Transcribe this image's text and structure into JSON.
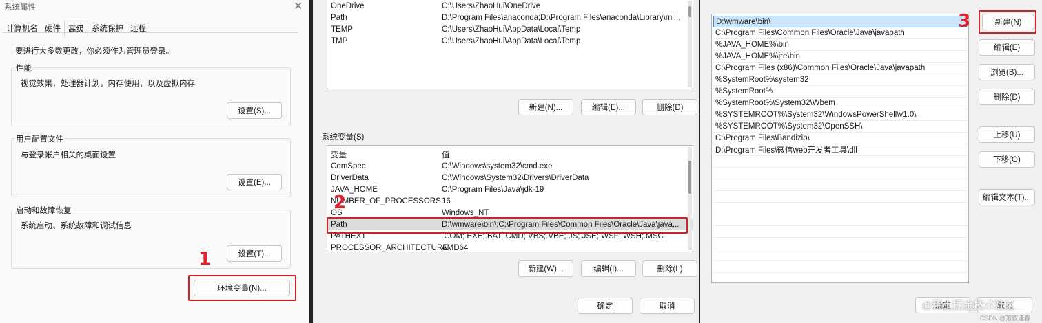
{
  "p1": {
    "title": "系统属性",
    "tabs": [
      "计算机名",
      "硬件",
      "高级",
      "系统保护",
      "远程"
    ],
    "admin_note": "要进行大多数更改，你必须作为管理员登录。",
    "perf": {
      "label": "性能",
      "desc": "视觉效果，处理器计划，内存使用，以及虚拟内存",
      "button": "设置(S)..."
    },
    "profile": {
      "label": "用户配置文件",
      "desc": "与登录帐户相关的桌面设置",
      "button": "设置(E)..."
    },
    "startup": {
      "label": "启动和故障恢复",
      "desc": "系统启动、系统故障和调试信息",
      "button": "设置(T)..."
    },
    "env_button": "环境变量(N)...",
    "marker": "1"
  },
  "p2": {
    "user_vars": [
      {
        "name": "OneDrive",
        "value": "C:\\Users\\ZhaoHui\\OneDrive"
      },
      {
        "name": "Path",
        "value": "D:\\Program Files\\anaconda;D:\\Program Files\\anaconda\\Library\\mi..."
      },
      {
        "name": "TEMP",
        "value": "C:\\Users\\ZhaoHui\\AppData\\Local\\Temp"
      },
      {
        "name": "TMP",
        "value": "C:\\Users\\ZhaoHui\\AppData\\Local\\Temp"
      }
    ],
    "user_buttons": [
      "新建(N)...",
      "编辑(E)...",
      "删除(D)"
    ],
    "sys_label": "系统变量(S)",
    "sys_header": {
      "name": "变量",
      "value": "值"
    },
    "sys_vars": [
      {
        "name": "ComSpec",
        "value": "C:\\Windows\\system32\\cmd.exe"
      },
      {
        "name": "DriverData",
        "value": "C:\\Windows\\System32\\Drivers\\DriverData"
      },
      {
        "name": "JAVA_HOME",
        "value": "C:\\Program Files\\Java\\jdk-19"
      },
      {
        "name": "NUMBER_OF_PROCESSORS",
        "value": "16"
      },
      {
        "name": "OS",
        "value": "Windows_NT"
      },
      {
        "name": "Path",
        "value": "D:\\wmware\\bin\\;C:\\Program Files\\Common Files\\Oracle\\Java\\java..."
      },
      {
        "name": "PATHEXT",
        "value": ".COM;.EXE;.BAT;.CMD;.VBS;.VBE;.JS;.JSE;.WSF;.WSH;.MSC"
      },
      {
        "name": "PROCESSOR_ARCHITECTURE",
        "value": "AMD64"
      }
    ],
    "selected_index": 5,
    "sys_buttons": [
      "新建(W)...",
      "编辑(I)...",
      "删除(L)"
    ],
    "ok": "确定",
    "cancel": "取消",
    "marker": "2"
  },
  "p3": {
    "paths": [
      "D:\\wmware\\bin\\",
      "C:\\Program Files\\Common Files\\Oracle\\Java\\javapath",
      "%JAVA_HOME%\\bin",
      "%JAVA_HOME%\\jre\\bin",
      "C:\\Program Files (x86)\\Common Files\\Oracle\\Java\\javapath",
      "%SystemRoot%\\system32",
      "%SystemRoot%",
      "%SystemRoot%\\System32\\Wbem",
      "%SYSTEMROOT%\\System32\\WindowsPowerShell\\v1.0\\",
      "%SYSTEMROOT%\\System32\\OpenSSH\\",
      "C:\\Program Files\\Bandizip\\",
      "D:\\Program Files\\微信web开发者工具\\dll"
    ],
    "buttons": [
      "新建(N)",
      "编辑(E)",
      "浏览(B)...",
      "删除(D)",
      "上移(U)",
      "下移(O)",
      "编辑文本(T)..."
    ],
    "ok": "确定",
    "cancel": "取消",
    "marker": "3",
    "watermark": "@稀土掘金技术社区",
    "credit": "CSDN @落叙逢春"
  }
}
